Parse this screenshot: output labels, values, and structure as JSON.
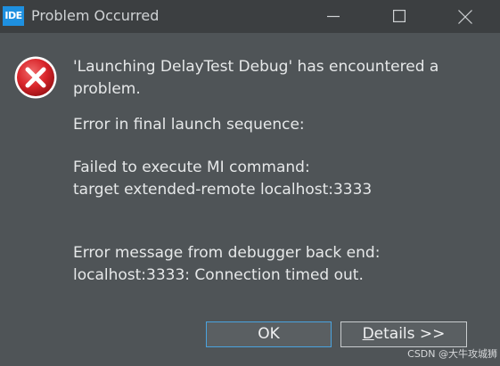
{
  "window": {
    "app_icon_text": "IDE",
    "title": "Problem Occurred"
  },
  "message": {
    "line1": "'Launching DelayTest Debug' has encountered a",
    "line2": "problem.",
    "line3": "Error in final launch sequence:",
    "line4": "Failed to execute MI command:",
    "line5": "target extended-remote localhost:3333",
    "line6": "Error message from debugger back end:",
    "line7": "localhost:3333: Connection timed out."
  },
  "buttons": {
    "ok_label": "OK",
    "details_mnemonic": "D",
    "details_rest": "etails >>"
  },
  "watermark": "CSDN @大牛攻城狮",
  "colors": {
    "background": "#4f5457",
    "titlebar": "#3c3f41",
    "text": "#e6e8e9",
    "error_red": "#d9262b",
    "focus_border": "#4aa3df"
  }
}
